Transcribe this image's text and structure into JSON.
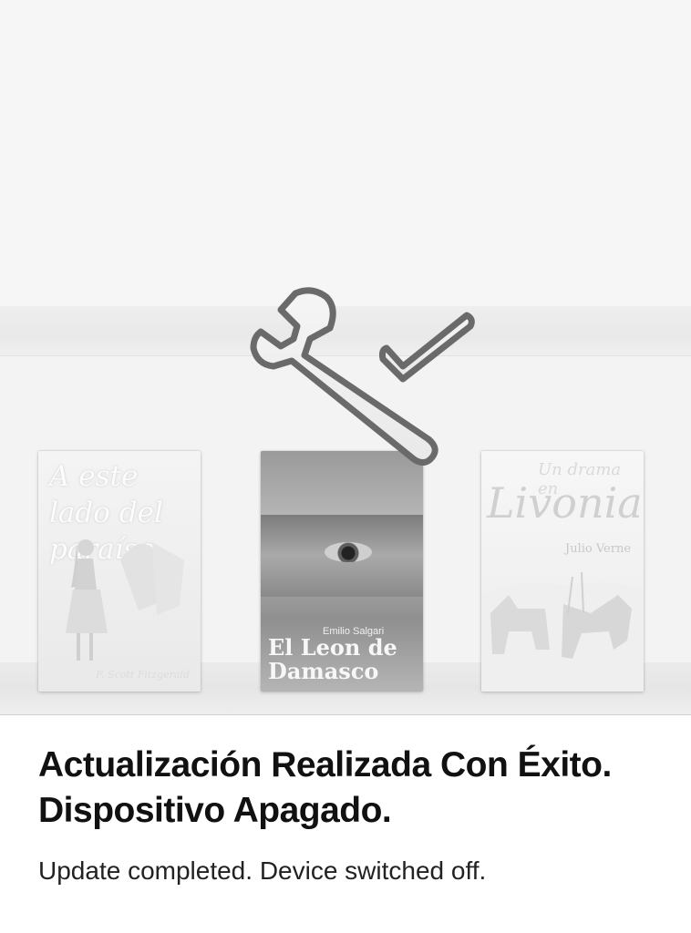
{
  "books": [
    {
      "title": "A este lado del paraíso",
      "author": "F. Scott Fitzgerald"
    },
    {
      "title": "El Leon de Damasco",
      "author": "Emilio Salgari"
    },
    {
      "title_small": "Un drama en",
      "title_big": "Livonia",
      "author": "Julio Verne"
    }
  ],
  "icons": {
    "overlay": "wrench-checkmark-icon"
  },
  "message": {
    "title_line1": "Actualización Realizada Con Éxito.",
    "title_line2": "Dispositivo Apagado.",
    "subtitle": "Update completed. Device switched off."
  }
}
